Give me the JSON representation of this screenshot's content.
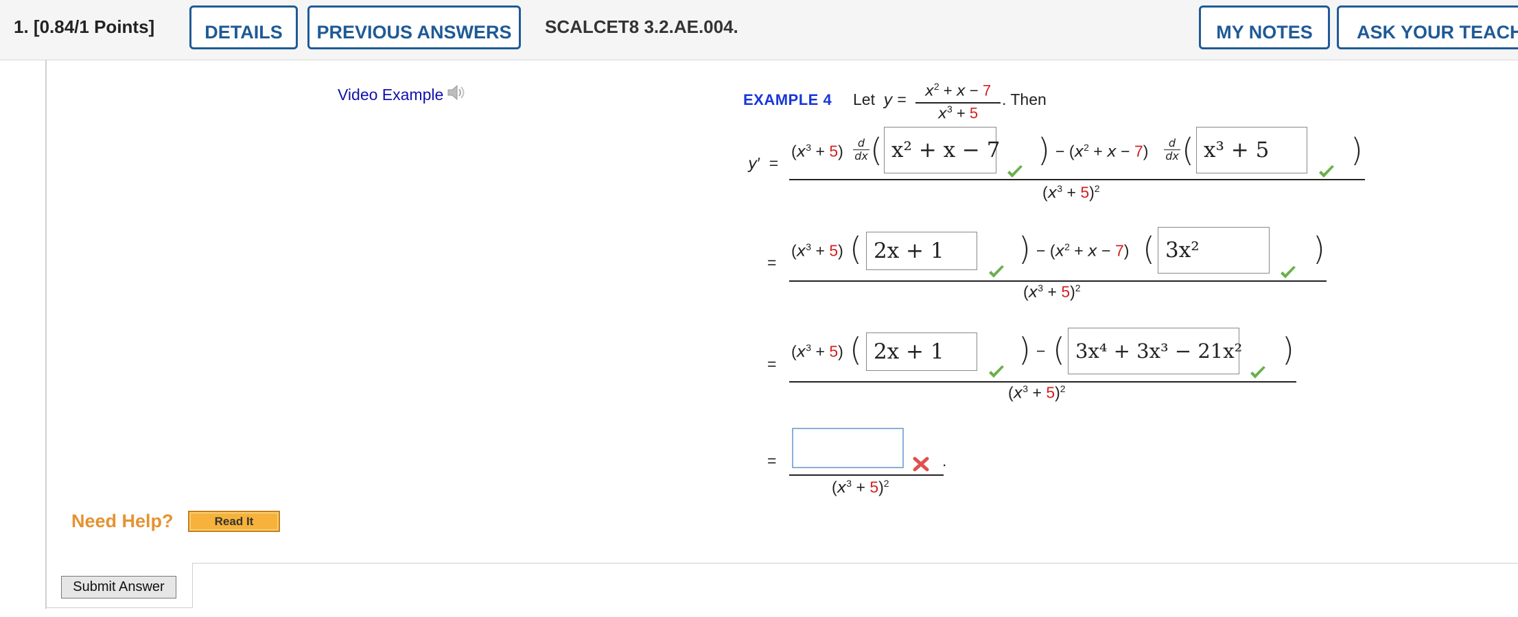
{
  "header": {
    "question_number": "1.",
    "points": "[0.84/1 Points]",
    "details_label": "DETAILS",
    "previous_answers_label": "PREVIOUS ANSWERS",
    "question_id": "SCALCET8 3.2.AE.004.",
    "my_notes_label": "MY NOTES",
    "ask_teacher_label": "ASK YOUR TEACHER"
  },
  "video": {
    "label": "Video Example"
  },
  "example": {
    "heading": "EXAMPLE 4",
    "let_text": "Let",
    "then_text": ". Then"
  },
  "answers": {
    "a1": "x² + x − 7",
    "a2": "x³ + 5",
    "a3": "2x + 1",
    "a4": "3x²",
    "a5": "2x + 1",
    "a6": "3x⁴ + 3x³ − 21x²",
    "a7": ""
  },
  "status": {
    "a1": "correct",
    "a2": "correct",
    "a3": "correct",
    "a4": "correct",
    "a5": "correct",
    "a6": "correct",
    "a7": "incorrect"
  },
  "colors": {
    "accent": "#1f5a96",
    "red_constant": "#d42020",
    "check": "#6ab04c",
    "cross": "#e05050"
  },
  "help": {
    "need_help": "Need Help?",
    "read_it": "Read It"
  },
  "submit_label": "Submit Answer"
}
